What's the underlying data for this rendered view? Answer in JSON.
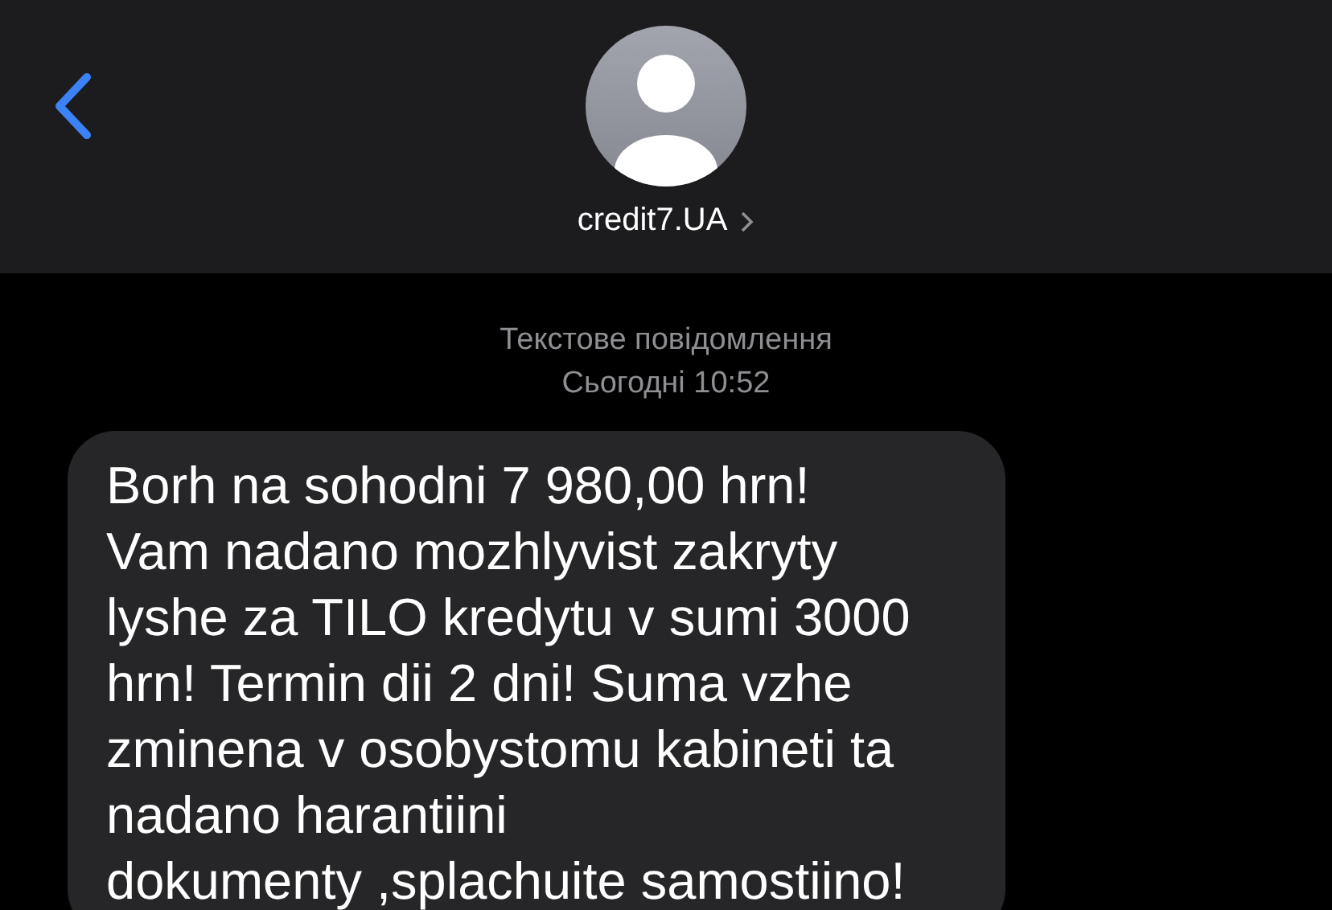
{
  "header": {
    "contact": "credit7.UA"
  },
  "thread": {
    "service": "Текстове повідомлення",
    "timestamp": "Сьогодні 10:52"
  },
  "messages": [
    {
      "kind": "received",
      "lines": [
        "Borh na sohodni 7 980,00 hrn!",
        "Vam nadano mozhlyvist zakryty",
        "lyshe za TILO kredytu v sumi 3000",
        "hrn! Termin dii 2 dni! Suma vzhe",
        "zminena v osobystomu kabineti ta",
        "nadano harantiini",
        "dokumenty ,splachuite samostiino!"
      ]
    }
  ]
}
